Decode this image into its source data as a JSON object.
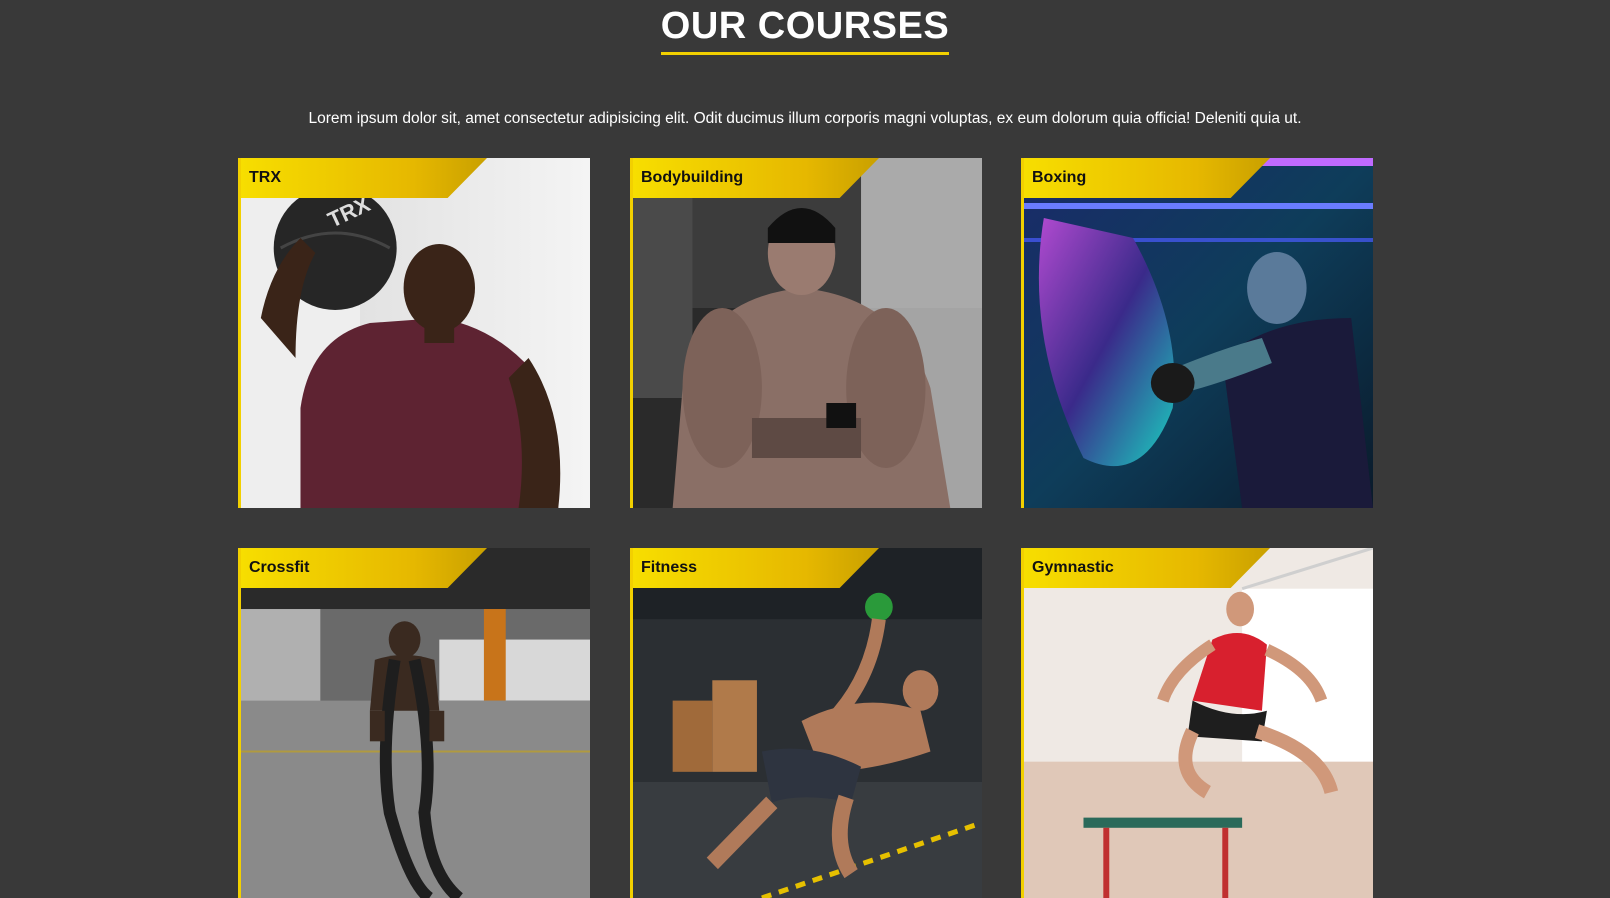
{
  "section": {
    "title": "OUR COURSES",
    "intro": "Lorem ipsum dolor sit, amet consectetur adipisicing elit. Odit ducimus illum corporis magni voluptas, ex eum dolorum quia officia! Deleniti quia ut."
  },
  "accent_color": "#f2d000",
  "background_color": "#393939",
  "courses": [
    {
      "label": "TRX"
    },
    {
      "label": "Bodybuilding"
    },
    {
      "label": "Boxing"
    },
    {
      "label": "Crossfit"
    },
    {
      "label": "Fitness"
    },
    {
      "label": "Gymnastic"
    }
  ]
}
